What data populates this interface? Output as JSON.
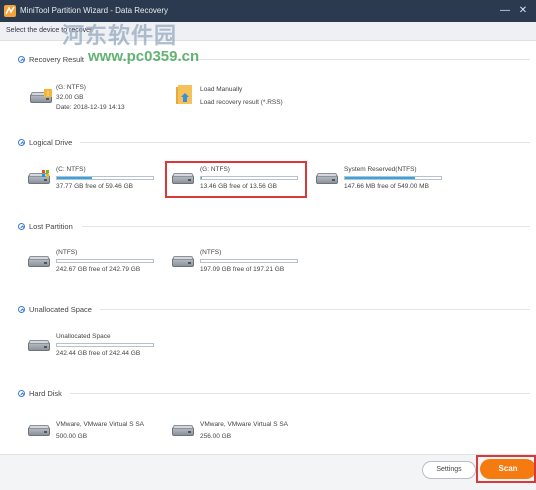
{
  "window": {
    "title": "MiniTool Partition Wizard - Data Recovery",
    "minimize": "—",
    "close": "✕"
  },
  "subheader": {
    "text": "Select the device to recover"
  },
  "watermark": {
    "cn": "河东软件园",
    "url": "www.pc0359.cn"
  },
  "sections": {
    "recovery_result": {
      "title": "Recovery Result",
      "item1": {
        "name": "(G: NTFS)",
        "size": "32.00 GB",
        "date": "Date: 2018-12-19 14:13"
      },
      "item2": {
        "name": "Load Manually",
        "desc": "Load recovery result (*.RSS)"
      }
    },
    "logical_drive": {
      "title": "Logical Drive",
      "items": [
        {
          "name": "(C: NTFS)",
          "free": "37.77 GB free of 59.46 GB",
          "used_fraction": 0.36
        },
        {
          "name": "(G: NTFS)",
          "free": "13.46 GB free of 13.56 GB",
          "used_fraction": 0.01
        },
        {
          "name": "System Reserved(NTFS)",
          "free": "147.66 MB free of 549.00 MB",
          "used_fraction": 0.73
        }
      ]
    },
    "lost_partition": {
      "title": "Lost Partition",
      "items": [
        {
          "name": "(NTFS)",
          "free": "242.67 GB free of 242.79 GB",
          "used_fraction": 0.0
        },
        {
          "name": "(NTFS)",
          "free": "197.09 GB free of 197.21 GB",
          "used_fraction": 0.0
        }
      ]
    },
    "unallocated_space": {
      "title": "Unallocated Space",
      "items": [
        {
          "name": "Unallocated Space",
          "free": "242.44 GB free of 242.44 GB",
          "used_fraction": 0.0
        }
      ]
    },
    "hard_disk": {
      "title": "Hard Disk",
      "items": [
        {
          "name": "VMware, VMware Virtual S SA",
          "size": "500.00 GB"
        },
        {
          "name": "VMware, VMware Virtual S SA",
          "size": "256.00 GB"
        }
      ]
    }
  },
  "footer": {
    "settings_label": "Settings",
    "scan_label": "Scan"
  },
  "colors": {
    "titlebar": "#2b3a4e",
    "usage_fill": "#31a6e6",
    "scan_button": "#f57a10",
    "highlight": "#d83a3a"
  }
}
